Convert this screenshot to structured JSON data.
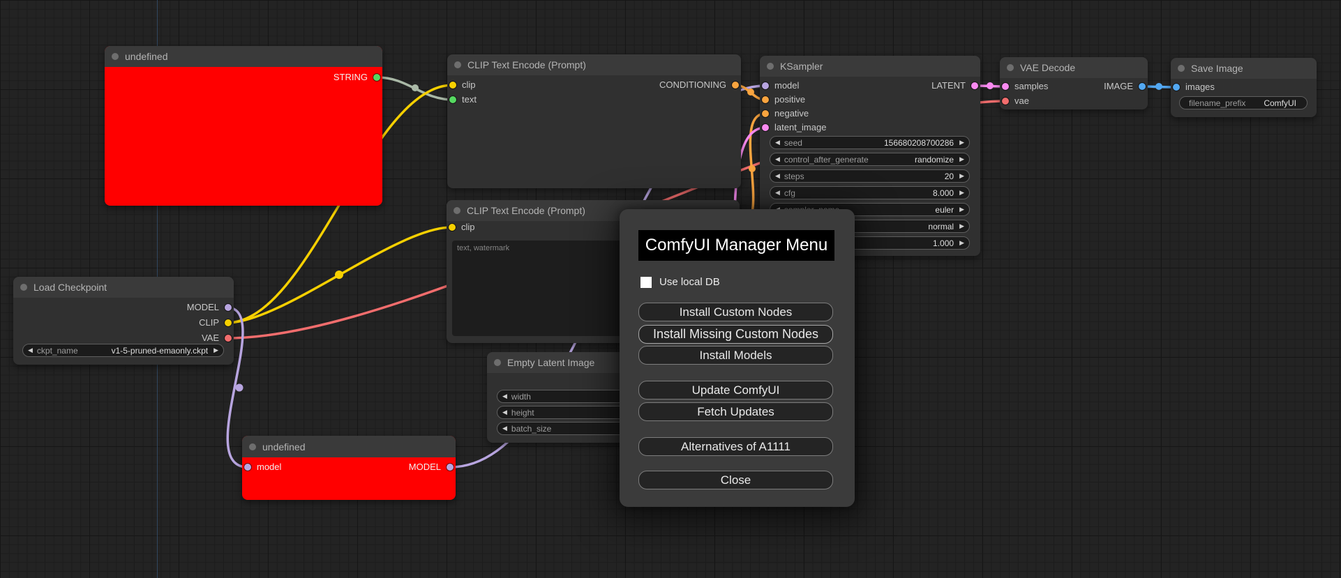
{
  "palette": {
    "model": "#b8a5e0",
    "clip": "#f6d000",
    "vae": "#f26d6d",
    "conditioning": "#f9a43f",
    "latent": "#f98af0",
    "image": "#53a8f2",
    "string_wire": "#a9b8a6",
    "string_port": "#56d961",
    "error_node_body": "#ff0000",
    "node_header": "#3a3a3a",
    "dialog_bg": "#3b3b3b",
    "dialog_title_bg": "#000000"
  },
  "icons": {
    "widget_left_arrow": "◀",
    "widget_right_arrow": "▶"
  },
  "nodes": {
    "undefined_top": {
      "title": "undefined",
      "output_label": "STRING"
    },
    "clip_encode_1": {
      "title": "CLIP Text Encode (Prompt)",
      "inputs": {
        "clip": "clip",
        "text": "text"
      },
      "output_label": "CONDITIONING"
    },
    "clip_encode_2": {
      "title": "CLIP Text Encode (Prompt)",
      "inputs": {
        "clip": "clip"
      },
      "text_value": "text, watermark"
    },
    "load_checkpoint": {
      "title": "Load Checkpoint",
      "outputs": {
        "model": "MODEL",
        "clip": "CLIP",
        "vae": "VAE"
      },
      "widgets": {
        "ckpt_name": {
          "label": "ckpt_name",
          "value": "v1-5-pruned-emaonly.ckpt"
        }
      }
    },
    "ksampler": {
      "title": "KSampler",
      "inputs": {
        "model": "model",
        "positive": "positive",
        "negative": "negative",
        "latent_image": "latent_image"
      },
      "output_label": "LATENT",
      "widgets": [
        {
          "label": "seed",
          "value": "156680208700286"
        },
        {
          "label": "control_after_generate",
          "value": "randomize"
        },
        {
          "label": "steps",
          "value": "20"
        },
        {
          "label": "cfg",
          "value": "8.000"
        },
        {
          "label": "sampler_name",
          "value": "euler"
        },
        {
          "label": "",
          "value": "normal"
        },
        {
          "label": "",
          "value": "1.000"
        }
      ]
    },
    "vae_decode": {
      "title": "VAE Decode",
      "inputs": {
        "samples": "samples",
        "vae": "vae"
      },
      "output_label": "IMAGE"
    },
    "save_image": {
      "title": "Save Image",
      "inputs": {
        "images": "images"
      },
      "widgets": {
        "filename_prefix": {
          "label": "filename_prefix",
          "value": "ComfyUI"
        }
      }
    },
    "empty_latent": {
      "title": "Empty Latent Image",
      "widgets": [
        {
          "label": "width"
        },
        {
          "label": "height"
        },
        {
          "label": "batch_size"
        }
      ]
    },
    "undefined_bottom": {
      "title": "undefined",
      "input_label": "model",
      "output_label": "MODEL"
    }
  },
  "dialog": {
    "title": "ComfyUI Manager Menu",
    "use_local_db_label": "Use local DB",
    "buttons": {
      "install_custom_nodes": "Install Custom Nodes",
      "install_missing": "Install Missing Custom Nodes",
      "install_models": "Install Models",
      "update_comfyui": "Update ComfyUI",
      "fetch_updates": "Fetch Updates",
      "alternatives": "Alternatives of A1111",
      "close": "Close"
    }
  }
}
